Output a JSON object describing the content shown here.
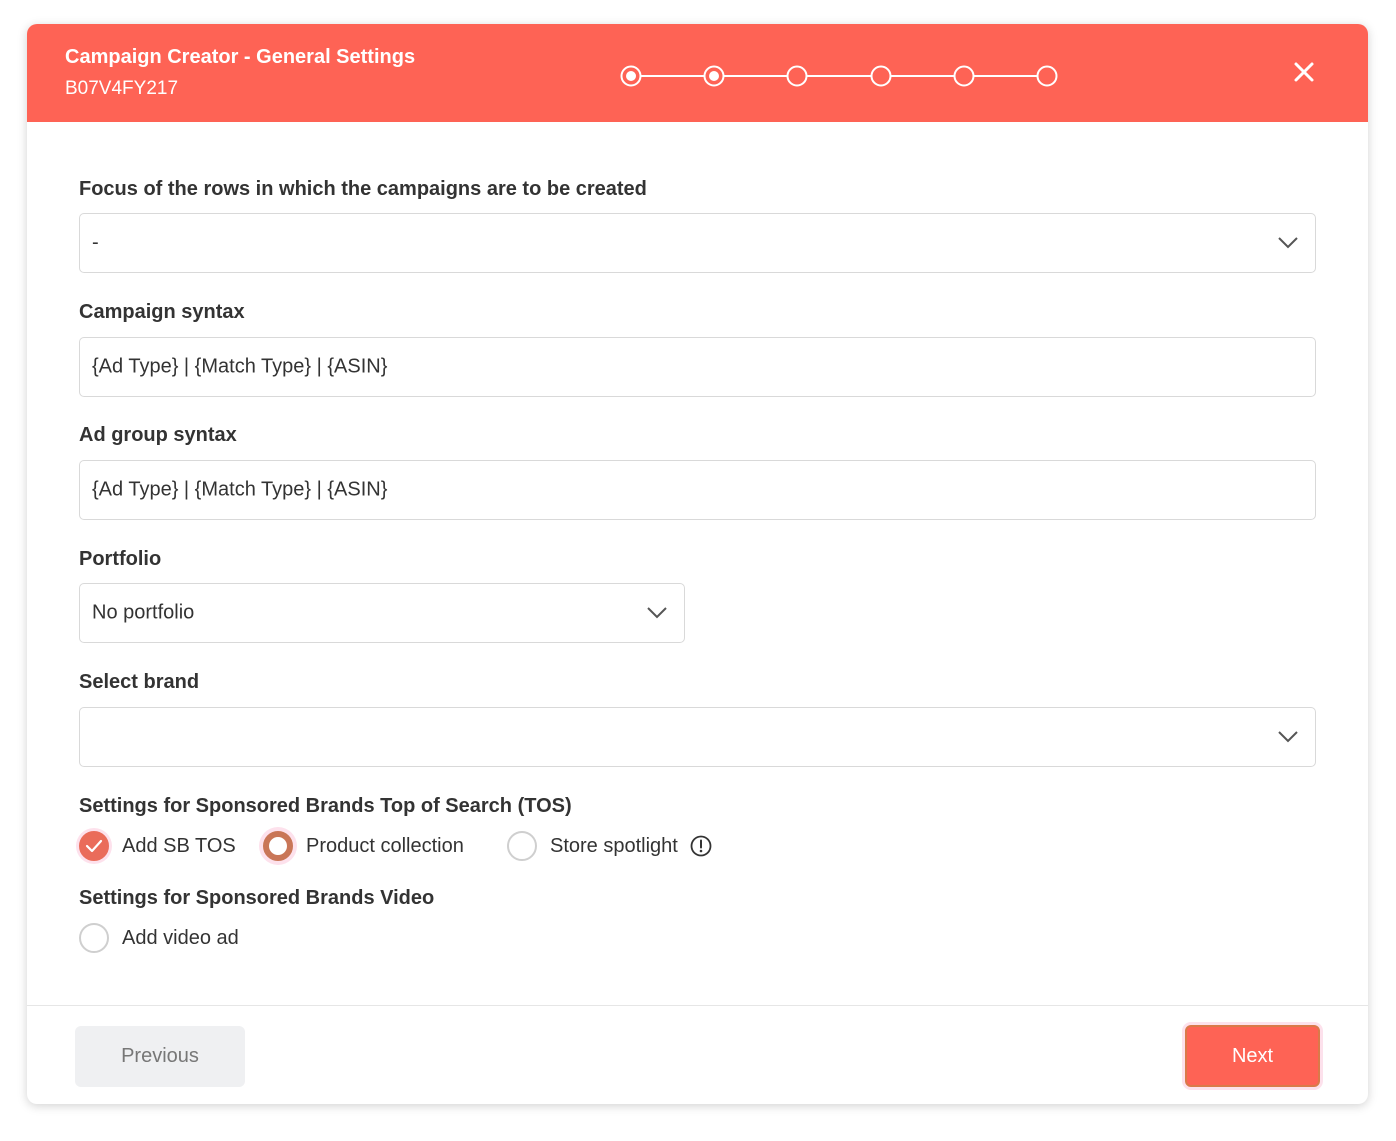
{
  "header": {
    "title": "Campaign Creator - General Settings",
    "subtitle": "B07V4FY217",
    "steps_total": 6,
    "steps_completed": 2,
    "accent_color": "#fe6355"
  },
  "fields": {
    "focus": {
      "label": "Focus of the rows in which the campaigns are to be created",
      "value": "-"
    },
    "campaign_syntax": {
      "label": "Campaign syntax",
      "value": "{Ad Type} | {Match Type} | {ASIN}"
    },
    "ad_group_syntax": {
      "label": "Ad group syntax",
      "value": "{Ad Type} | {Match Type} | {ASIN}"
    },
    "portfolio": {
      "label": "Portfolio",
      "value": "No portfolio"
    },
    "brand": {
      "label": "Select brand",
      "value": ""
    }
  },
  "sb_tos": {
    "label": "Settings for Sponsored Brands Top of Search (TOS)",
    "options": [
      {
        "label": "Add SB TOS",
        "state": "checked"
      },
      {
        "label": "Product collection",
        "state": "selected"
      },
      {
        "label": "Store spotlight",
        "state": "unchecked",
        "icon": "info-icon"
      }
    ]
  },
  "sb_video": {
    "label": "Settings for Sponsored Brands Video",
    "options": [
      {
        "label": "Add video ad",
        "state": "unchecked"
      }
    ]
  },
  "footer": {
    "previous_label": "Previous",
    "next_label": "Next"
  },
  "icons": {
    "close": "close-icon",
    "dropdown": "chevron-down-icon",
    "info": "info-icon"
  }
}
